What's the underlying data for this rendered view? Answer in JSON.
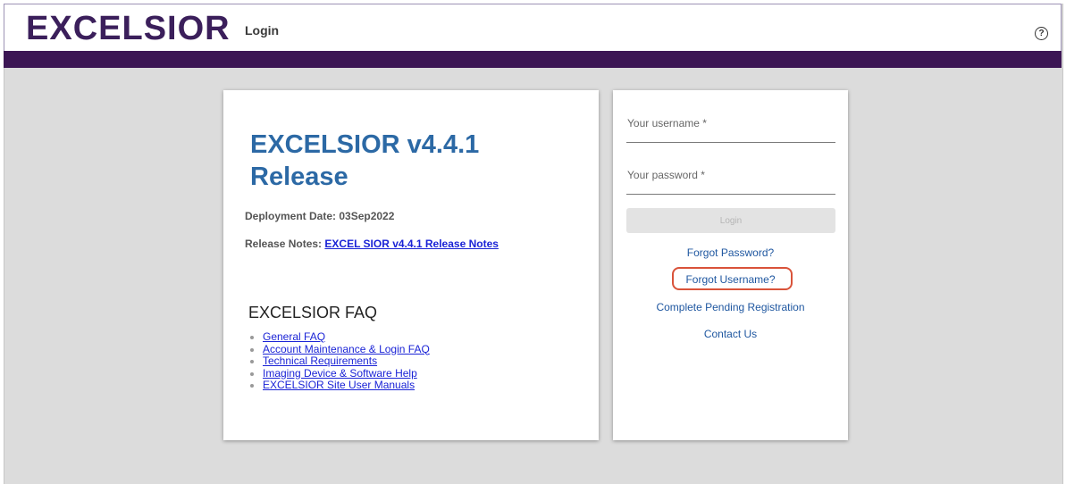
{
  "header": {
    "logo": "EXCELSIOR",
    "page_label": "Login",
    "help_icon": "question-circle-icon",
    "help_glyph": "?"
  },
  "release": {
    "title": "EXCELSIOR v4.4.1 Release",
    "deployment_label": "Deployment Date: 03Sep2022",
    "notes_prefix": "Release Notes:",
    "notes_link": "EXCEL SIOR v4.4.1 Release Notes",
    "faq_title": "EXCELSIOR FAQ",
    "faq_links": [
      "General FAQ",
      "Account Maintenance & Login FAQ",
      "Technical Requirements",
      "Imaging Device & Software Help",
      "EXCELSIOR Site User Manuals"
    ]
  },
  "login": {
    "username_placeholder": "Your username *",
    "password_placeholder": "Your password *",
    "login_button": "Login",
    "forgot_password": "Forgot Password?",
    "forgot_username": "Forgot Username?",
    "complete_registration": "Complete Pending Registration",
    "contact_us": "Contact Us"
  },
  "colors": {
    "brand_purple": "#3c1654",
    "title_blue": "#2c69a5",
    "link_blue": "#1a23d6",
    "highlight_red": "#d9533a"
  }
}
